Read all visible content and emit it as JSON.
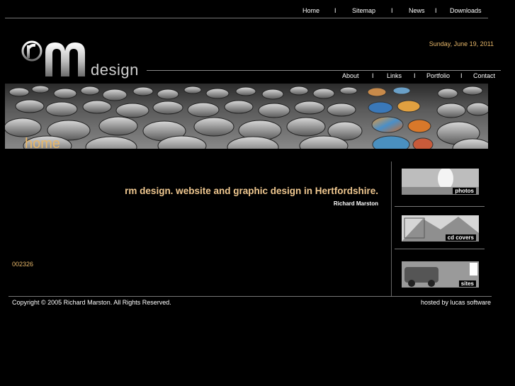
{
  "top_nav": {
    "home": "Home",
    "sitemap": "Sitemap",
    "news": "News",
    "downloads": "Downloads",
    "separator": "I"
  },
  "logo": {
    "rm": "rM",
    "design": "design"
  },
  "date": "Sunday, June 19, 2011",
  "sub_nav": {
    "about": "About",
    "links": "Links",
    "portfolio": "Portfolio",
    "contact": "Contact",
    "separator": "I"
  },
  "banner": {
    "page_label": "home"
  },
  "main": {
    "headline": "rm design. website and graphic design in Hertfordshire.",
    "author": "Richard Marston",
    "counter": "002326"
  },
  "thumbnails": [
    {
      "label": "photos",
      "icon": "photos-thumbnail"
    },
    {
      "label": "cd covers",
      "icon": "cd-covers-thumbnail"
    },
    {
      "label": "sites",
      "icon": "sites-thumbnail"
    }
  ],
  "footer": {
    "copyright": "Copyright © 2005 Richard Marston. All Rights Reserved.",
    "hosted": "hosted by lucas software"
  },
  "colors": {
    "accent": "#e8b86a",
    "background": "#000000",
    "text": "#ffffff"
  }
}
